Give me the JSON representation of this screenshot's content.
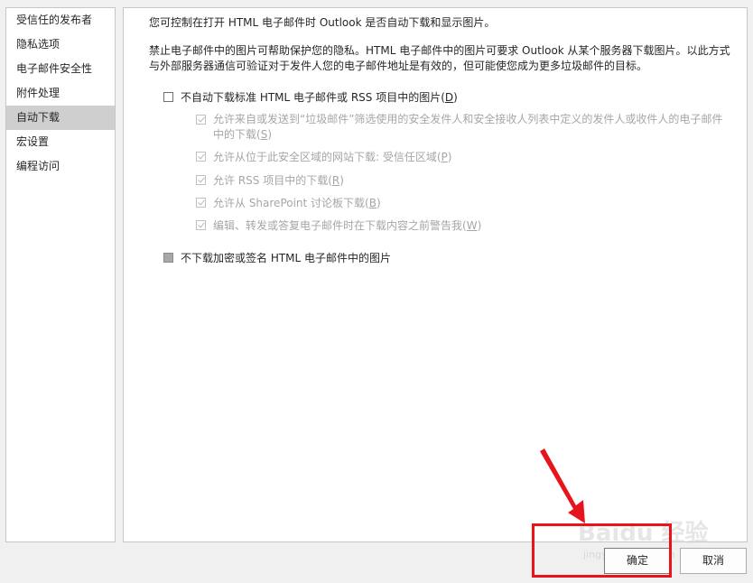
{
  "sidebar": {
    "items": [
      {
        "label": "受信任的发布者"
      },
      {
        "label": "隐私选项"
      },
      {
        "label": "电子邮件安全性"
      },
      {
        "label": "附件处理"
      },
      {
        "label": "自动下载",
        "selected": true
      },
      {
        "label": "宏设置"
      },
      {
        "label": "编程访问"
      }
    ]
  },
  "main": {
    "intro": "您可控制在打开 HTML 电子邮件时 Outlook 是否自动下载和显示图片。",
    "description_lines": [
      "禁止电子邮件中的图片可帮助保护您的隐私。HTML 电子邮件中的图片可要求 Outlook 从某个服务器下载图片。以此方式",
      "与外部服务器通信可验证对于发件人您的电子邮件地址是有效的，但可能使您成为更多垃圾邮件的目标。"
    ],
    "options": {
      "no_auto_download": {
        "label": "不自动下载标准 HTML 电子邮件或 RSS 项目中的图片(",
        "key": "D",
        "suffix": ")",
        "checked": false
      },
      "sub_options": [
        {
          "label": "允许来自或发送到“垃圾邮件”筛选使用的安全发件人和安全接收人列表中定义的发件人或收件人的电子邮件中的下载(",
          "key": "S",
          "suffix": ")",
          "checked": true,
          "disabled": true
        },
        {
          "label": "允许从位于此安全区域的网站下载: 受信任区域(",
          "key": "P",
          "suffix": ")",
          "checked": true,
          "disabled": true
        },
        {
          "label": "允许 RSS 项目中的下载(",
          "key": "R",
          "suffix": ")",
          "checked": true,
          "disabled": true
        },
        {
          "label": "允许从 SharePoint 讨论板下载(",
          "key": "B",
          "suffix": ")",
          "checked": true,
          "disabled": true
        },
        {
          "label": "编辑、转发或答复电子邮件时在下载内容之前警告我(",
          "key": "W",
          "suffix": ")",
          "checked": true,
          "disabled": true
        }
      ],
      "encrypted": {
        "label": "不下载加密或签名 HTML 电子邮件中的图片",
        "state": "indeterminate"
      }
    }
  },
  "footer": {
    "ok_label": "确定",
    "cancel_label": "取消"
  },
  "overlay": {
    "watermark": "Baidu 经验",
    "watermark_sub": "jingyan.baidu.com",
    "annotation_color": "#e8141c"
  }
}
